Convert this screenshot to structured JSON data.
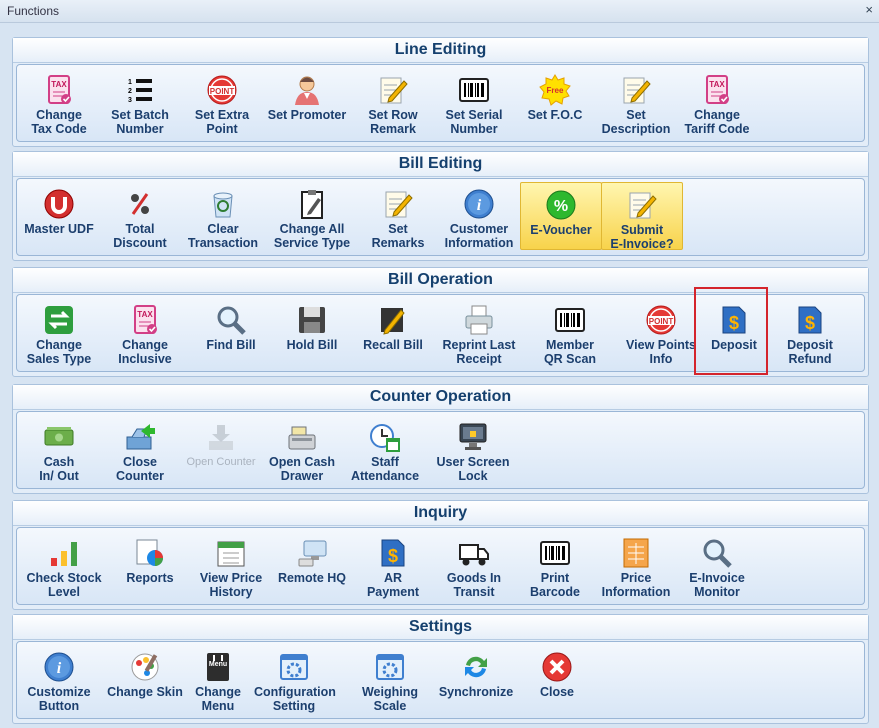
{
  "window": {
    "title": "Functions",
    "close_glyph": "×"
  },
  "panels": [
    {
      "title": "Line Editing",
      "buttons": [
        {
          "label": "Change\nTax Code",
          "icon": "tax-icon"
        },
        {
          "label": "Set Batch\nNumber",
          "icon": "numbered-list-icon"
        },
        {
          "label": "Set Extra\nPoint",
          "icon": "point-badge-icon"
        },
        {
          "label": "Set Promoter",
          "icon": "person-icon"
        },
        {
          "label": "Set Row\nRemark",
          "icon": "note-pencil-icon"
        },
        {
          "label": "Set Serial\nNumber",
          "icon": "barcode-icon"
        },
        {
          "label": "Set F.O.C",
          "icon": "free-badge-icon"
        },
        {
          "label": "Set\nDescription",
          "icon": "note-pencil-icon"
        },
        {
          "label": "Change\nTariff Code",
          "icon": "tax-icon"
        }
      ]
    },
    {
      "title": "Bill Editing",
      "buttons": [
        {
          "label": "Master UDF",
          "icon": "udf-icon"
        },
        {
          "label": "Total\nDiscount",
          "icon": "percent-icon"
        },
        {
          "label": "Clear\nTransaction",
          "icon": "recycle-bin-icon"
        },
        {
          "label": "Change All\nService Type",
          "icon": "clipboard-icon"
        },
        {
          "label": "Set\nRemarks",
          "icon": "note-pencil-icon"
        },
        {
          "label": "Customer\nInformation",
          "icon": "info-icon"
        },
        {
          "label": "E-Voucher",
          "icon": "percent-circle-icon"
        },
        {
          "label": "Submit\nE-Invoice?",
          "icon": "note-pencil-icon"
        }
      ]
    },
    {
      "title": "Bill Operation",
      "buttons": [
        {
          "label": "Change\nSales Type",
          "icon": "swap-icon"
        },
        {
          "label": "Change\nInclusive",
          "icon": "tax-icon"
        },
        {
          "label": "Find Bill",
          "icon": "magnifier-icon"
        },
        {
          "label": "Hold Bill",
          "icon": "floppy-disk-icon"
        },
        {
          "label": "Recall Bill",
          "icon": "recall-pencil-icon"
        },
        {
          "label": "Reprint Last\nReceipt",
          "icon": "printer-icon"
        },
        {
          "label": "Member\nQR Scan",
          "icon": "barcode-icon"
        },
        {
          "label": "View Points\nInfo",
          "icon": "point-badge-icon"
        },
        {
          "label": "Deposit",
          "icon": "dollar-document-icon"
        },
        {
          "label": "Deposit\nRefund",
          "icon": "dollar-document-icon"
        }
      ]
    },
    {
      "title": "Counter Operation",
      "buttons": [
        {
          "label": "Cash\nIn/ Out",
          "icon": "cash-icon"
        },
        {
          "label": "Close\nCounter",
          "icon": "close-counter-icon"
        },
        {
          "label": "Open Counter",
          "icon": "download-tray-icon"
        },
        {
          "label": "Open Cash\nDrawer",
          "icon": "cash-register-icon"
        },
        {
          "label": "Staff\nAttendance",
          "icon": "clock-calendar-icon"
        },
        {
          "label": "User Screen\nLock",
          "icon": "monitor-lock-icon"
        }
      ]
    },
    {
      "title": "Inquiry",
      "buttons": [
        {
          "label": "Check Stock\nLevel",
          "icon": "bar-chart-icon"
        },
        {
          "label": "Reports",
          "icon": "pie-report-icon"
        },
        {
          "label": "View Price\nHistory",
          "icon": "calendar-icon"
        },
        {
          "label": "Remote HQ",
          "icon": "remote-monitor-icon"
        },
        {
          "label": "AR\nPayment",
          "icon": "dollar-document-icon"
        },
        {
          "label": "Goods In\nTransit",
          "icon": "truck-icon"
        },
        {
          "label": "Print\nBarcode",
          "icon": "barcode-icon"
        },
        {
          "label": "Price\nInformation",
          "icon": "price-sheet-icon"
        },
        {
          "label": "E-Invoice\nMonitor",
          "icon": "magnifier-icon"
        }
      ]
    },
    {
      "title": "Settings",
      "buttons": [
        {
          "label": "Customize\nButton",
          "icon": "info-icon"
        },
        {
          "label": "Change Skin",
          "icon": "paint-icon"
        },
        {
          "label": "Change\nMenu",
          "icon": "menu-book-icon"
        },
        {
          "label": "Configuration\nSetting",
          "icon": "settings-window-icon"
        },
        {
          "label": "Weighing\nScale",
          "icon": "settings-window-icon"
        },
        {
          "label": "Synchronize",
          "icon": "sync-icon"
        },
        {
          "label": "Close",
          "icon": "close-icon"
        }
      ]
    }
  ],
  "highlighted_buttons": [
    "E-Voucher",
    "Submit\nE-Invoice?"
  ],
  "disabled_buttons": [
    "Open Counter"
  ],
  "selected_button": "Deposit",
  "colors": {
    "accent_text": "#1c3f6e",
    "highlight": "#f8d34b",
    "selection_outline": "#d4242c"
  }
}
